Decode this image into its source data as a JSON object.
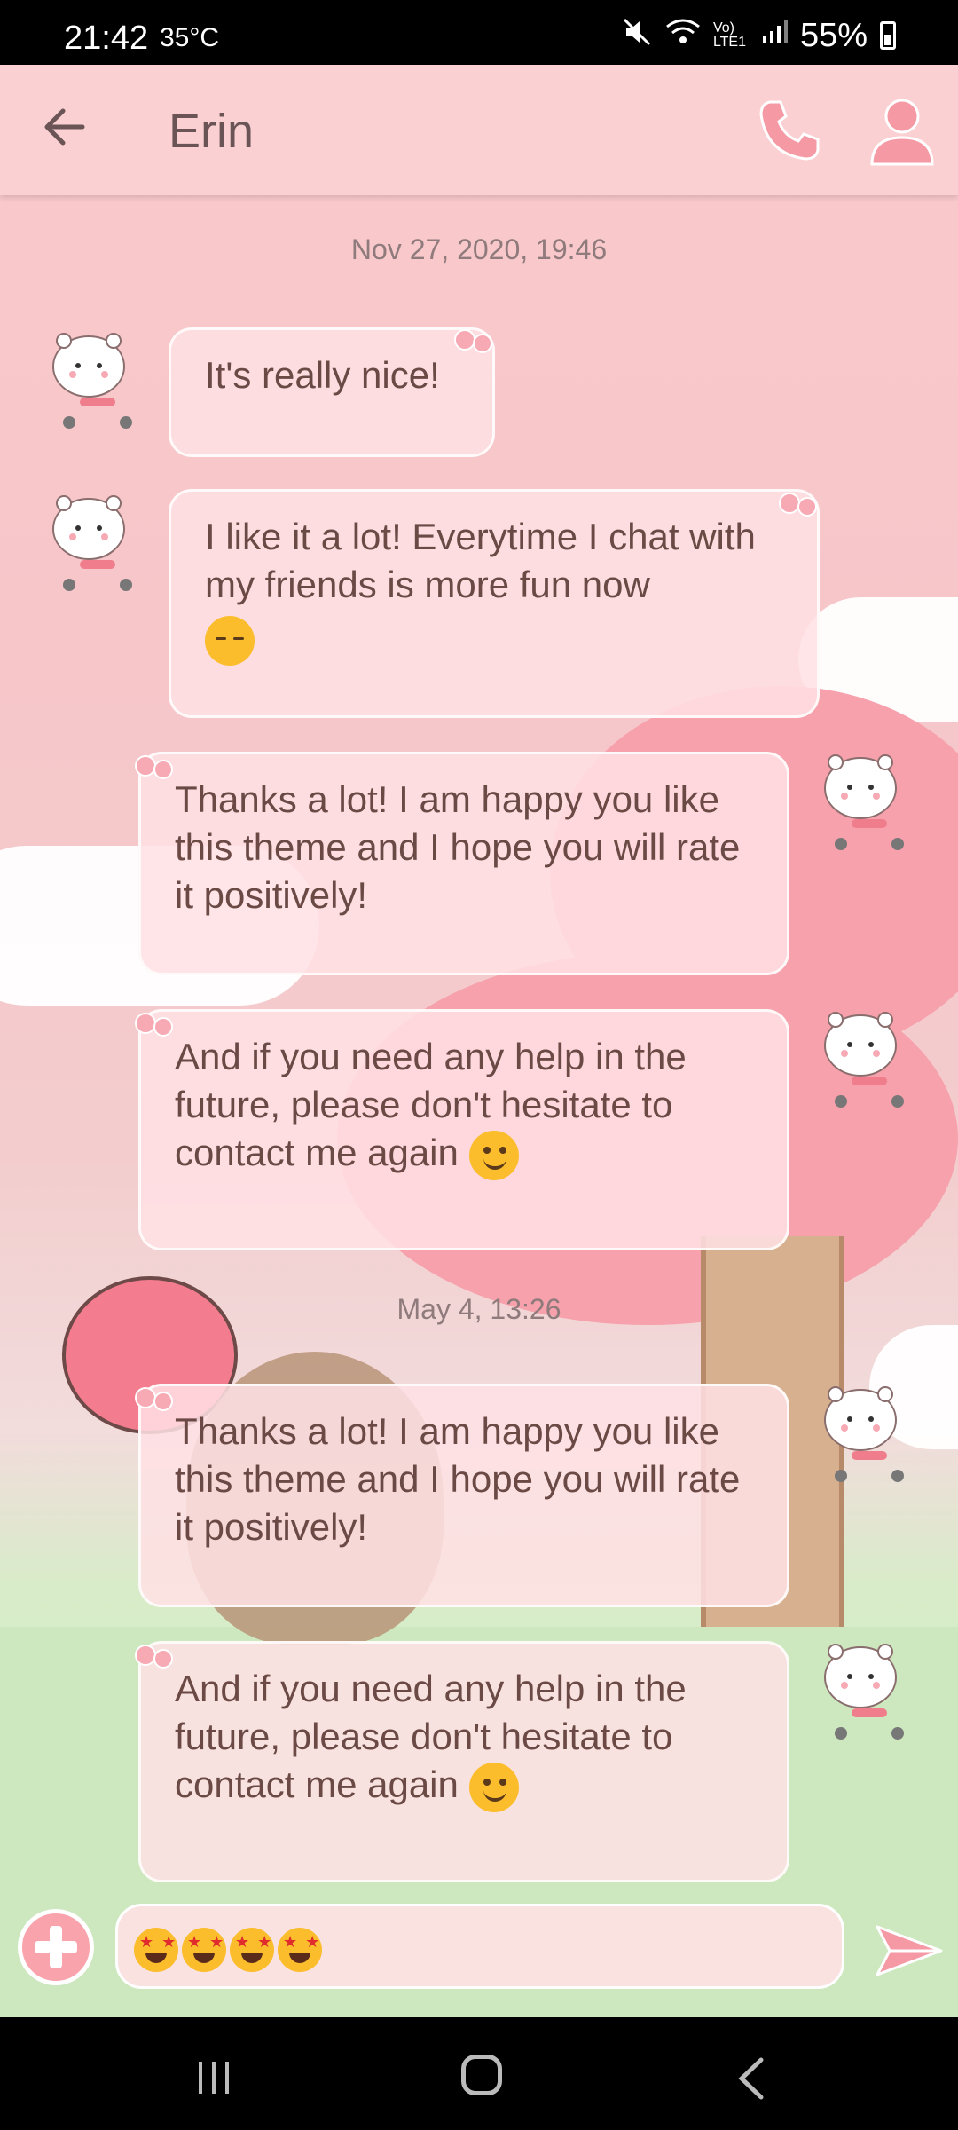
{
  "status_bar": {
    "time": "21:42",
    "temperature": "35°C",
    "network": "Vo) LTE1",
    "battery": "55%",
    "icons": [
      "mute-icon",
      "wifi-icon",
      "signal-icon",
      "battery-charging-icon"
    ]
  },
  "header": {
    "contact_name": "Erin",
    "icons": [
      "back-arrow-icon",
      "phone-icon",
      "person-icon"
    ],
    "accent_color": "#f59aa5"
  },
  "messages": [
    {
      "timestamp": "Nov 27, 2020, 19:46"
    },
    {
      "direction": "incoming",
      "text": "It's really nice!"
    },
    {
      "direction": "incoming",
      "text": "I like it a lot! Everytime I chat with my friends is more fun now",
      "emoji": "pensive-face"
    },
    {
      "direction": "outgoing",
      "text": "Thanks a lot! I am happy you like this theme and I hope you will rate it positively!"
    },
    {
      "direction": "outgoing",
      "text": "And if you need any help in the future, please don't hesitate to contact me again",
      "emoji": "smiling-face"
    },
    {
      "timestamp": "May 4, 13:26"
    },
    {
      "direction": "outgoing",
      "text": "Thanks a lot! I am happy you like this theme and I hope you will rate it positively!"
    },
    {
      "direction": "outgoing",
      "text": "And if you need any help in the future, please don't hesitate to contact me again",
      "emoji": "smiling-face"
    }
  ],
  "composer": {
    "input_value": "🤩🤩🤩🤩",
    "icons": [
      "add-attachment-icon",
      "send-icon"
    ]
  },
  "nav_bar": {
    "icons": [
      "recent-apps-icon",
      "home-icon",
      "back-icon"
    ]
  }
}
